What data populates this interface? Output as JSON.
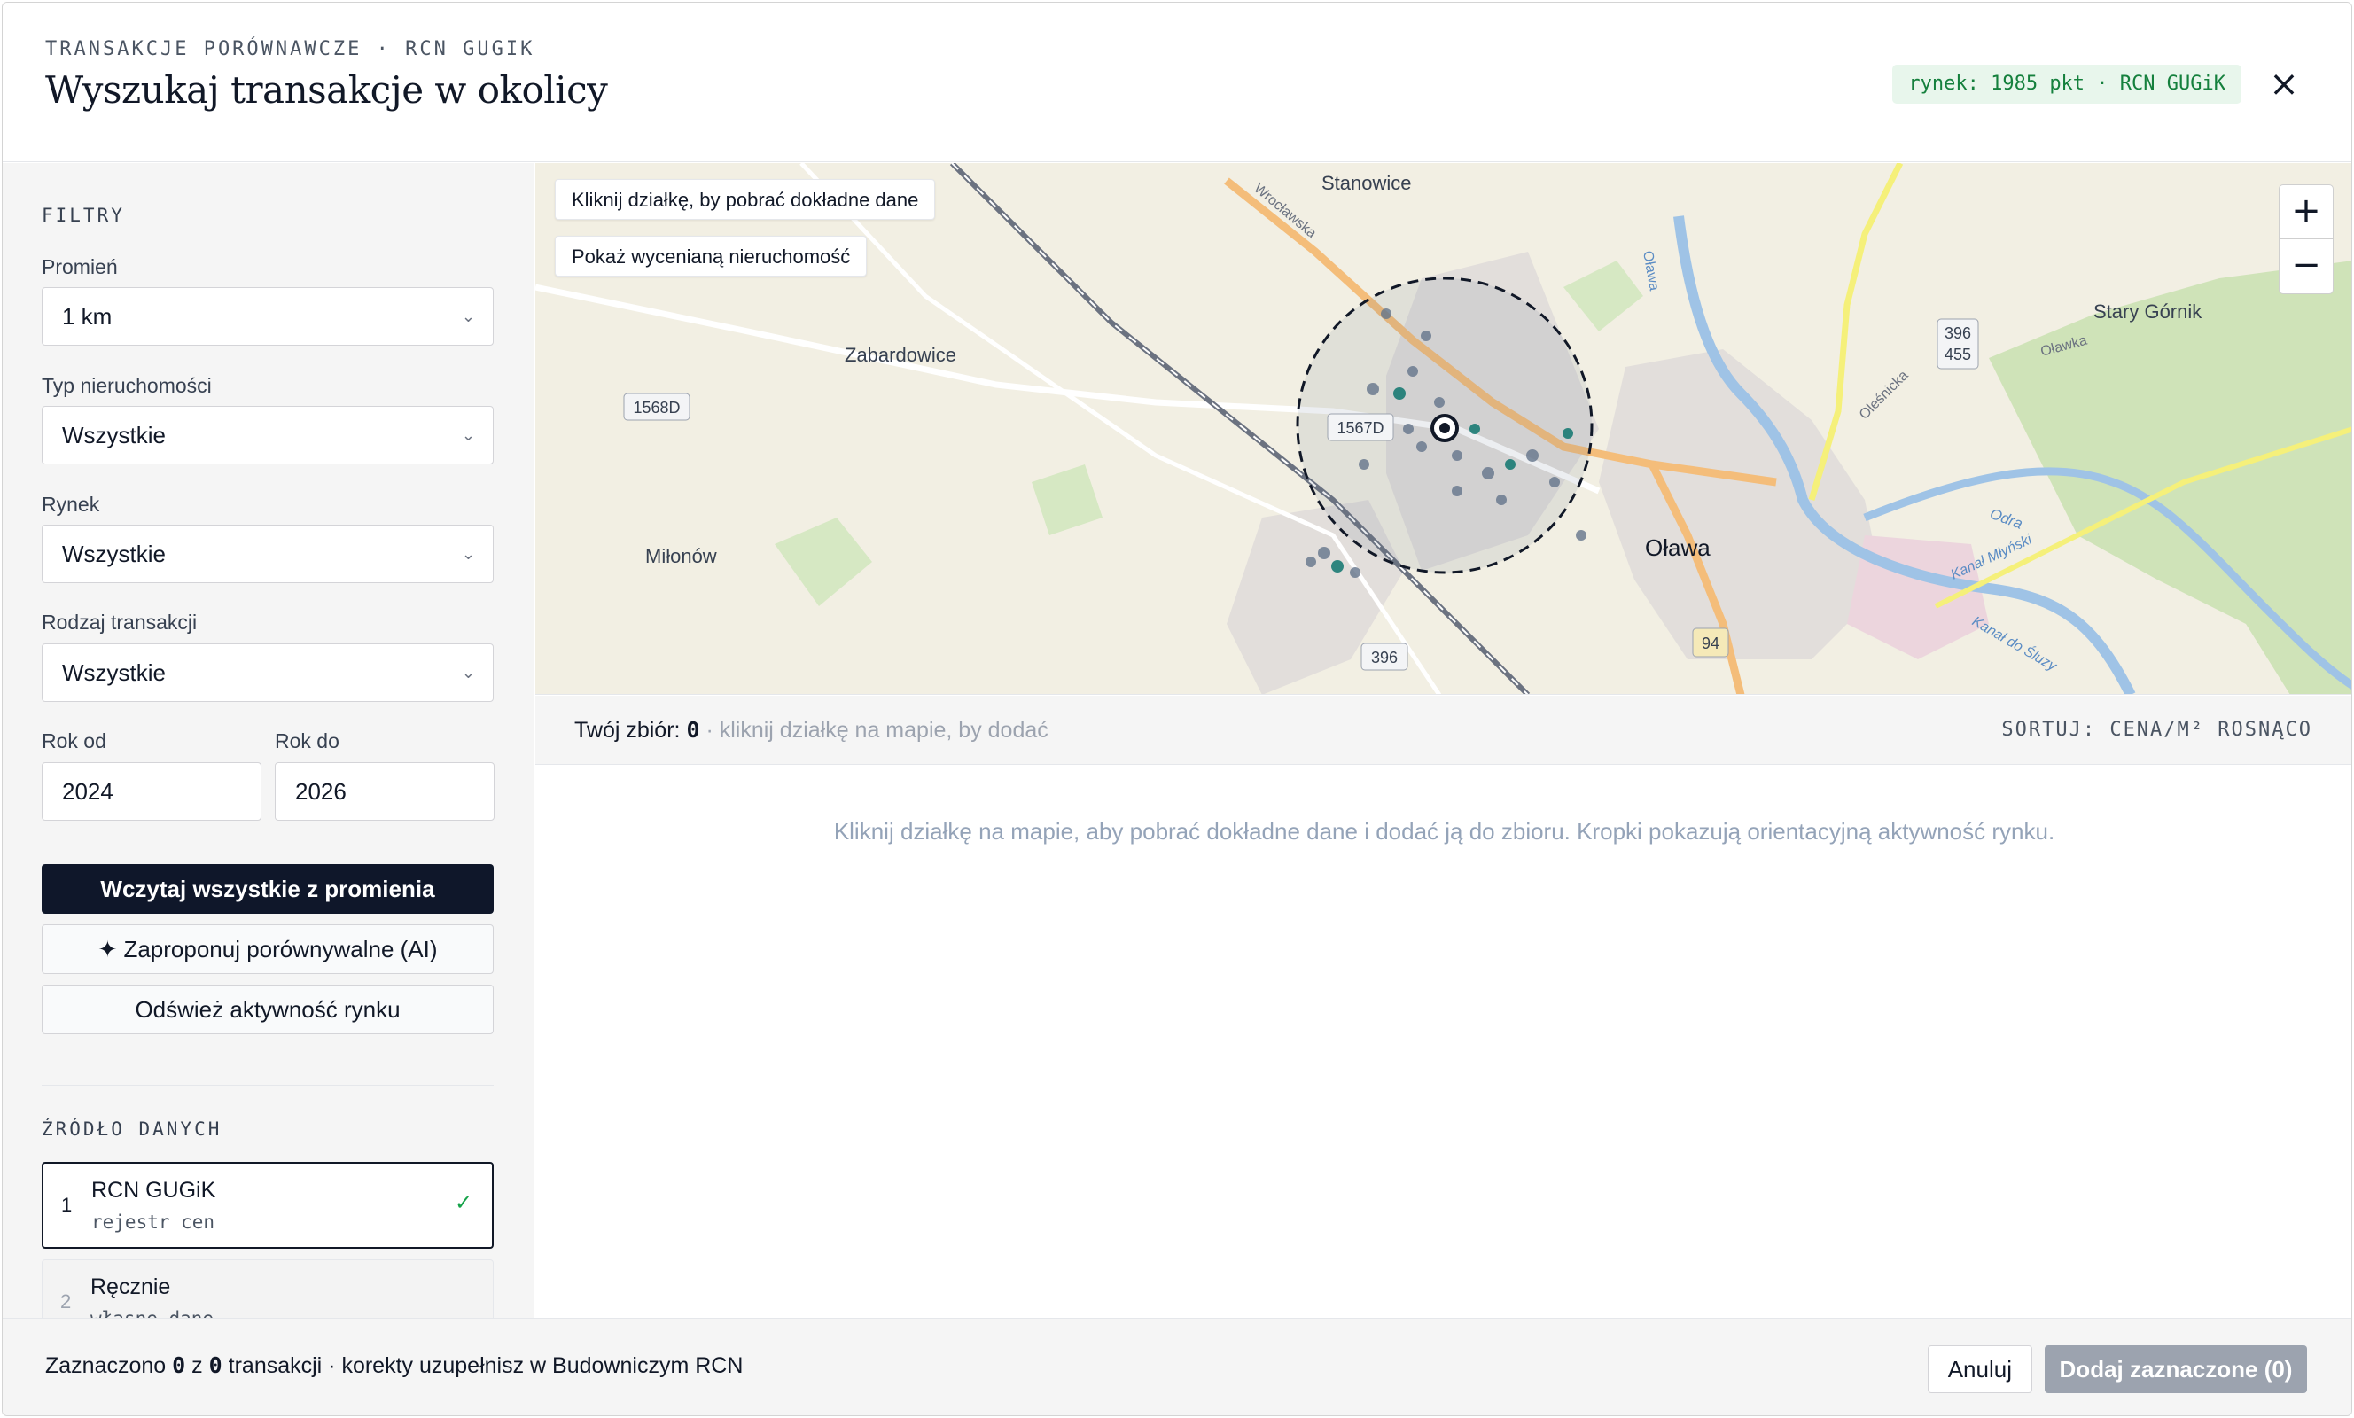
{
  "header": {
    "eyebrow": "TRANSAKCJE PORÓWNAWCZE · RCN GUGIK",
    "title": "Wyszukaj transakcje w okolicy",
    "market_badge": "rynek: 1985 pkt · RCN GUGiK",
    "close_icon": "×"
  },
  "sidebar": {
    "filters_title": "FILTRY",
    "radius": {
      "label": "Promień",
      "value": "1 km"
    },
    "property_type": {
      "label": "Typ nieruchomości",
      "value": "Wszystkie"
    },
    "market": {
      "label": "Rynek",
      "value": "Wszystkie"
    },
    "transaction_type": {
      "label": "Rodzaj transakcji",
      "value": "Wszystkie"
    },
    "year_from": {
      "label": "Rok od",
      "value": "2024"
    },
    "year_to": {
      "label": "Rok do",
      "value": "2026"
    },
    "load_all_label": "Wczytaj wszystkie z promienia",
    "suggest_ai_label": "✦ Zaproponuj porównywalne (AI)",
    "refresh_label": "Odśwież aktywność rynku",
    "source_title": "ŹRÓDŁO DANYCH",
    "sources": [
      {
        "num": "1",
        "name": "RCN GUGiK",
        "sub": "rejestr cen",
        "selected": true,
        "check": "✓"
      },
      {
        "num": "2",
        "name": "Ręcznie",
        "sub": "własne dane",
        "selected": false
      }
    ],
    "chevron_icon": "⌄"
  },
  "map": {
    "tip_click": "Kliknij działkę, by pobrać dokładne dane",
    "tip_show": "Pokaż wycenianą nieruchomość",
    "zoom_in": "+",
    "zoom_out": "−",
    "places": {
      "stanowice": "Stanowice",
      "zabardowice": "Zabardowice",
      "milonow": "Miłonów",
      "olawa": "Oława",
      "stary_gornik": "Stary Górnik",
      "wroclawska": "Wrocławska",
      "olawka": "Oławka",
      "olesnicka": "Oleśnicka",
      "olawa_river": "Oława",
      "odra": "Odra",
      "kanal_mlynski": "Kanał Młyński",
      "kanal_do_sluzy": "Kanał do Śluzy"
    },
    "road_labels": {
      "r1568d": "1568D",
      "r1567d": "1567D",
      "r396_top": "396",
      "r455": "455",
      "r396": "396",
      "r94": "94"
    },
    "colors": {
      "radius_circle": "#111827",
      "dot_teal": "#0f766e",
      "dot_slate": "#64748b"
    }
  },
  "results": {
    "set_label": "Twój zbiór:",
    "set_count": "0",
    "set_hint": "· kliknij działkę na mapie, by dodać",
    "sort": "SORTUJ: CENA/M² ROSNĄCO",
    "empty": "Kliknij działkę na mapie, aby pobrać dokładne dane i dodać ją do zbioru. Kropki pokazują orientacyjną aktywność rynku."
  },
  "footer": {
    "selected_prefix": "Zaznaczono",
    "selected_count": "0",
    "of": "z",
    "total_count": "0",
    "suffix": "transakcji · korekty uzupełnisz w Budowniczym RCN",
    "cancel": "Anuluj",
    "add": "Dodaj zaznaczone (0)"
  }
}
